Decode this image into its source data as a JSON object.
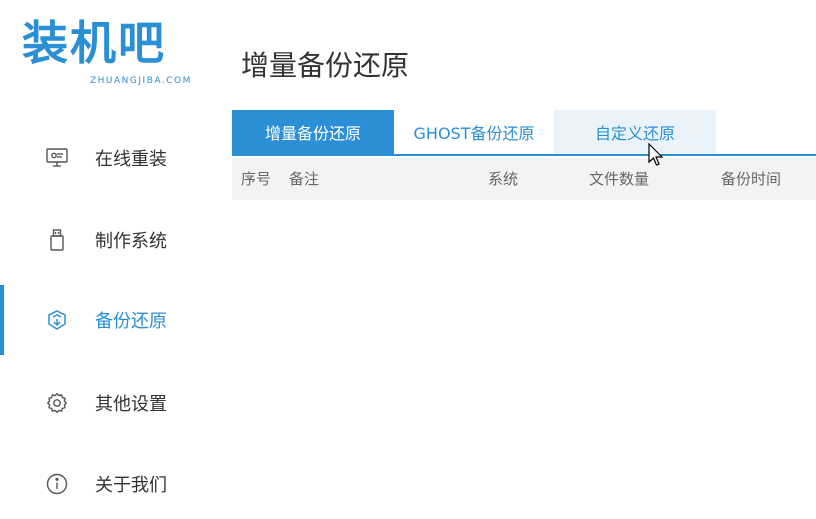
{
  "logo": {
    "text_cn": "装机吧",
    "text_en": "ZHUANGJIBA.COM"
  },
  "sidebar": {
    "items": [
      {
        "label": "在线重装",
        "icon": "monitor-icon"
      },
      {
        "label": "制作系统",
        "icon": "usb-drive-icon"
      },
      {
        "label": "备份还原",
        "icon": "backup-restore-icon",
        "active": true
      },
      {
        "label": "其他设置",
        "icon": "gear-icon"
      },
      {
        "label": "关于我们",
        "icon": "info-icon"
      }
    ]
  },
  "page": {
    "title": "增量备份还原"
  },
  "tabs": [
    {
      "label": "增量备份还原",
      "active": true
    },
    {
      "label": "GHOST备份还原",
      "active": false
    },
    {
      "label": "自定义还原",
      "active": false
    }
  ],
  "table": {
    "columns": [
      "序号",
      "备注",
      "系统",
      "文件数量",
      "备份时间"
    ],
    "rows": []
  },
  "colors": {
    "accent": "#2b8fd6",
    "tab_hover": "#eaf3fa",
    "header_bg": "#f3f3f3"
  }
}
